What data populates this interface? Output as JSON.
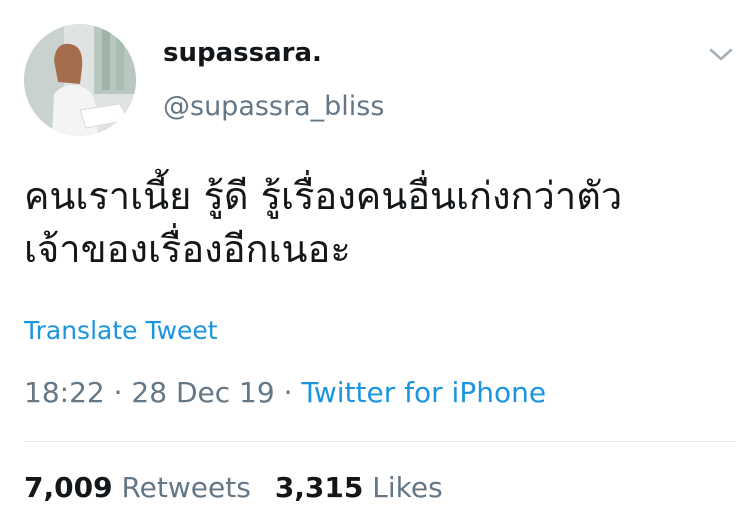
{
  "user": {
    "display_name": "supassara.",
    "handle": "@supassra_bliss",
    "avatar_icon": "profile-photo"
  },
  "menu_icon": "chevron-down-icon",
  "tweet": {
    "text_lines": [
      "คนเราเนี้ย รู้ดี รู้เรื่องคนอื่นเก่งกว่าตัว",
      "เจ้าของเรื่องอีกเนอะ"
    ],
    "translate_label": "Translate Tweet",
    "time": "18:22",
    "separator": "·",
    "date": "28 Dec 19",
    "source": "Twitter for iPhone"
  },
  "stats": {
    "retweets_count": "7,009",
    "retweets_label": "Retweets",
    "likes_count": "3,315",
    "likes_label": "Likes"
  },
  "colors": {
    "link_blue": "#1b95e0",
    "text_primary": "#14171a",
    "text_secondary": "#657786",
    "divider": "#e1e8ed"
  }
}
